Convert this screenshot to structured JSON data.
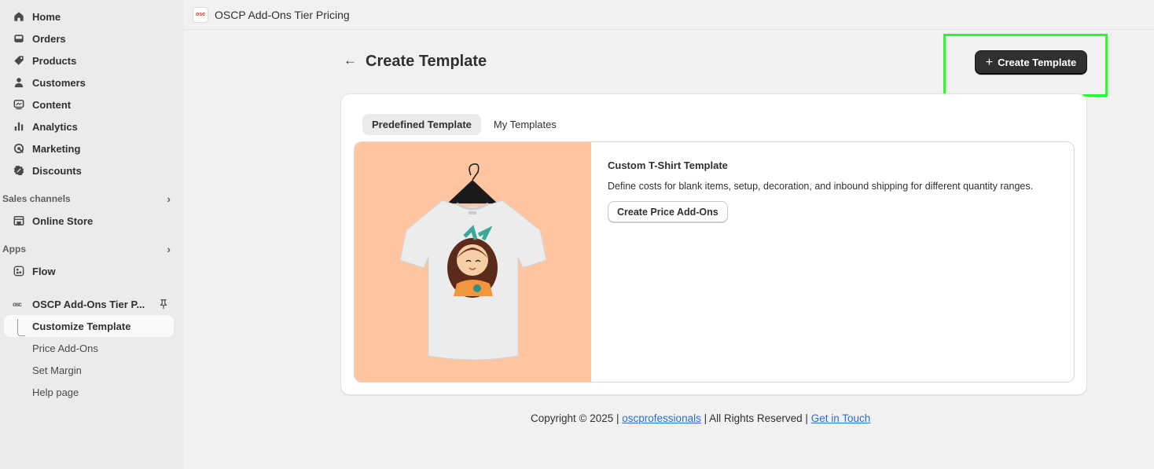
{
  "sidebar": {
    "items": [
      {
        "label": "Home",
        "icon": "home-icon"
      },
      {
        "label": "Orders",
        "icon": "orders-icon"
      },
      {
        "label": "Products",
        "icon": "tag-icon"
      },
      {
        "label": "Customers",
        "icon": "person-icon"
      },
      {
        "label": "Content",
        "icon": "content-icon"
      },
      {
        "label": "Analytics",
        "icon": "bar-chart-icon"
      },
      {
        "label": "Marketing",
        "icon": "marketing-icon"
      },
      {
        "label": "Discounts",
        "icon": "discount-icon"
      }
    ],
    "sales_channels_label": "Sales channels",
    "online_store_label": "Online Store",
    "apps_label": "Apps",
    "flow_label": "Flow",
    "app_name": "OSCP Add-Ons Tier P...",
    "app_logo_text": "osc",
    "sub_items": [
      "Customize Template",
      "Price Add-Ons",
      "Set Margin",
      "Help page"
    ]
  },
  "topbar": {
    "logo_text": "osc",
    "title": "OSCP Add-Ons Tier Pricing"
  },
  "page": {
    "back_icon": "arrow-left-icon",
    "title": "Create Template",
    "primary_button_label": "Create Template"
  },
  "card": {
    "tabs": [
      "Predefined Template",
      "My Templates"
    ],
    "template": {
      "title": "Custom T-Shirt Template",
      "description": "Define costs for blank items, setup, decoration, and inbound shipping for different quantity ranges.",
      "button_label": "Create Price Add-Ons",
      "image_bg": "#ffc4a0"
    }
  },
  "footer": {
    "copyright": "Copyright © 2025 |",
    "link1": "oscprofessionals",
    "separator": "| All Rights Reserved |",
    "link2": "Get in Touch"
  },
  "colors": {
    "primary_button": "#303030",
    "highlight": "#22ff22",
    "link": "#2c6ecb"
  }
}
